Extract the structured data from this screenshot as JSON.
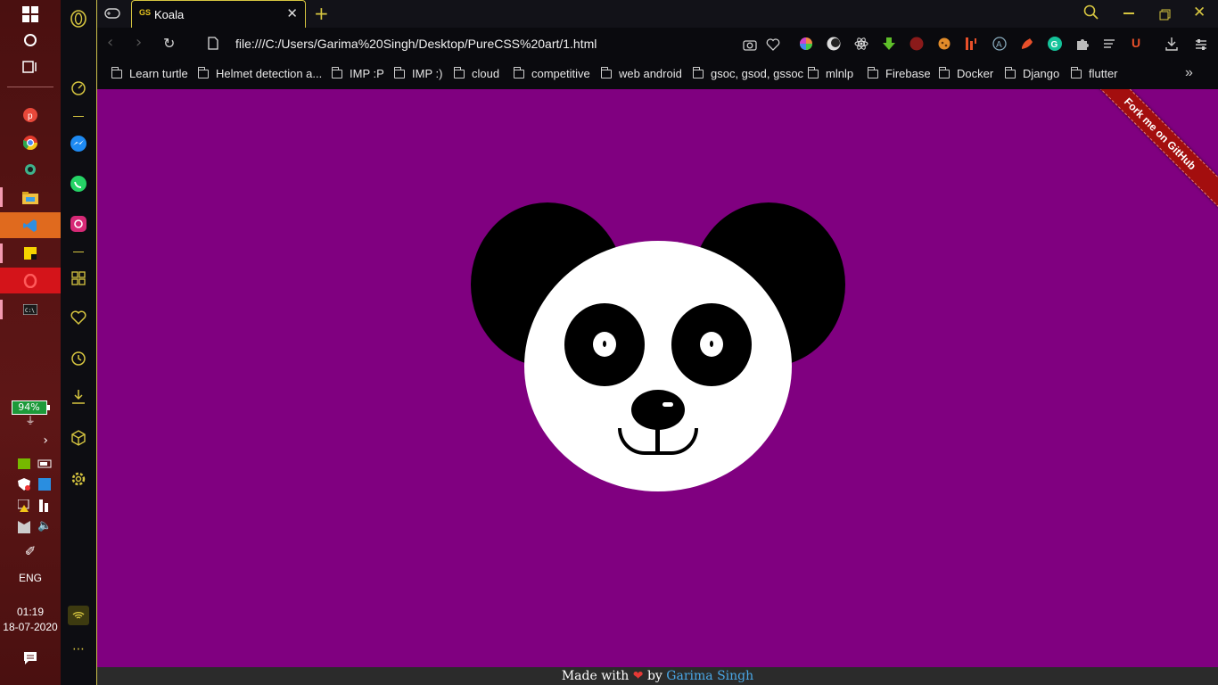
{
  "taskbar": {
    "battery": "94%",
    "language": "ENG",
    "time": "01:19",
    "date": "18-07-2020"
  },
  "tab": {
    "favicon_text": "GS",
    "title": "Koala"
  },
  "address": {
    "url": "file:///C:/Users/Garima%20Singh/Desktop/PureCSS%20art/1.html"
  },
  "bookmarks": [
    "Learn turtle",
    "Helmet detection a...",
    "IMP :P",
    "IMP :)",
    "cloud",
    "competitive",
    "web android",
    "gsoc, gsod, gssoc",
    "mlnlp",
    "Firebase",
    "Docker",
    "Django",
    "flutter"
  ],
  "page": {
    "ribbon": "Fork me on GitHub",
    "footer_prefix": "Made with",
    "footer_by": "by",
    "footer_author": "Garima Singh",
    "background": "#800080"
  }
}
